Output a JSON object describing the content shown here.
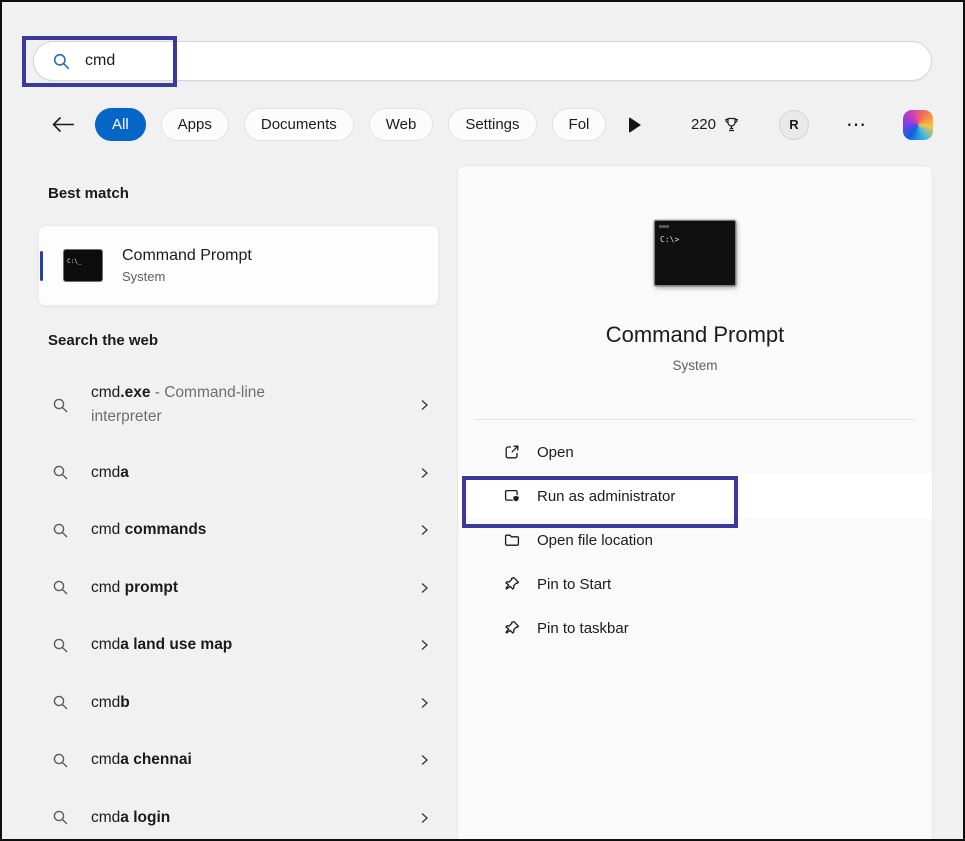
{
  "colors": {
    "annotation": "#3a3a9e",
    "accent": "#0467c8"
  },
  "search": {
    "value": "cmd"
  },
  "toolbar": {
    "tabs": [
      {
        "label": "All",
        "active": true
      },
      {
        "label": "Apps",
        "active": false
      },
      {
        "label": "Documents",
        "active": false
      },
      {
        "label": "Web",
        "active": false
      },
      {
        "label": "Settings",
        "active": false
      },
      {
        "label": "Fol",
        "active": false
      }
    ],
    "rewards_points": "220",
    "avatar_initial": "R",
    "more_icon": "⋯"
  },
  "left": {
    "best_match_header": "Best match",
    "best_match": {
      "title": "Command Prompt",
      "subtitle": "System"
    },
    "web_header": "Search the web",
    "suggestions": [
      {
        "typed": "cmd",
        "completion": ".exe",
        "extra": " - Command-line interpreter"
      },
      {
        "typed": "cmd",
        "completion": "a"
      },
      {
        "typed": "cmd",
        "completion": " commands"
      },
      {
        "typed": "cmd",
        "completion": " prompt"
      },
      {
        "typed": "cmd",
        "completion": "a land use map"
      },
      {
        "typed": "cmd",
        "completion": "b"
      },
      {
        "typed": "cmd",
        "completion": "a chennai"
      },
      {
        "typed": "cmd",
        "completion": "a login"
      }
    ]
  },
  "preview": {
    "title": "Command Prompt",
    "subtitle": "System",
    "actions": [
      {
        "label": "Open"
      },
      {
        "label": "Run as administrator",
        "highlighted": true
      },
      {
        "label": "Open file location"
      },
      {
        "label": "Pin to Start"
      },
      {
        "label": "Pin to taskbar"
      }
    ]
  }
}
